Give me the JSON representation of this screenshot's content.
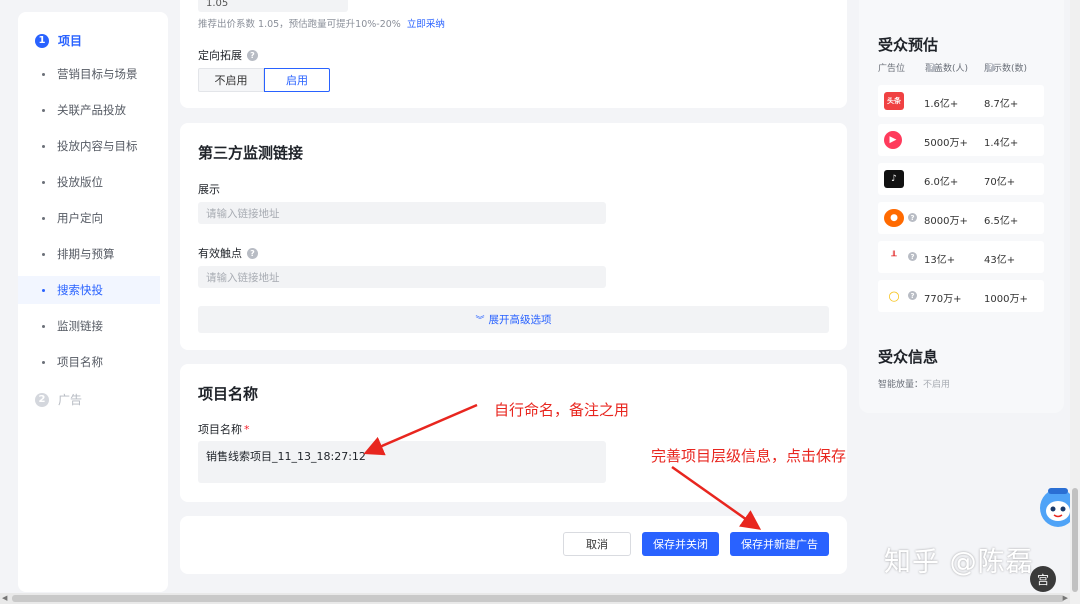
{
  "nav": {
    "step1": {
      "num": "1",
      "label": "项目"
    },
    "items": [
      {
        "label": "营销目标与场景"
      },
      {
        "label": "关联产品投放"
      },
      {
        "label": "投放内容与目标"
      },
      {
        "label": "投放版位"
      },
      {
        "label": "用户定向"
      },
      {
        "label": "排期与预算"
      },
      {
        "label": "搜索快投"
      },
      {
        "label": "监测链接"
      },
      {
        "label": "项目名称"
      }
    ],
    "selected_item": "搜索快投",
    "step2": {
      "num": "2",
      "label": "广告"
    }
  },
  "bid": {
    "value": "1.05",
    "hint": "推荐出价系数 1.05，预估跑量可提升10%-20%",
    "hint_link": "立即采纳"
  },
  "targeting_expand": {
    "label": "定向拓展",
    "options": [
      "不启用",
      "启用"
    ],
    "selected": "启用"
  },
  "monitor": {
    "title": "第三方监测链接",
    "show_label": "展示",
    "show_placeholder": "请输入链接地址",
    "touch_label": "有效触点",
    "touch_placeholder": "请输入链接地址",
    "expand_label": "展开高级选项"
  },
  "project_name": {
    "title": "项目名称",
    "label": "项目名称",
    "required_mark": "*",
    "value": "销售线索项目_11_13_18:27:12"
  },
  "actions": {
    "cancel": "取消",
    "save_close": "保存并关闭",
    "save_new": "保存并新建广告"
  },
  "audience": {
    "title": "受众预估",
    "columns": [
      "广告位",
      "覆盖数(人)",
      "展示数(数)"
    ],
    "rows": [
      {
        "logo_icon": "toutiao-logo-icon",
        "logo_text": "头条",
        "logo_color": "#f04142",
        "has_help": false,
        "coverage": "1.6亿+",
        "impressions": "8.7亿+"
      },
      {
        "logo_icon": "xigua-logo-icon",
        "logo_text": "▶",
        "logo_color": "#ff3b5c",
        "has_help": false,
        "coverage": "5000万+",
        "impressions": "1.4亿+"
      },
      {
        "logo_icon": "douyin-logo-icon",
        "logo_text": "♪",
        "logo_color": "#111111",
        "has_help": false,
        "coverage": "6.0亿+",
        "impressions": "70亿+"
      },
      {
        "logo_icon": "huoshan-logo-icon",
        "logo_text": "●",
        "logo_color": "#ff6a00",
        "has_help": true,
        "coverage": "8000万+",
        "impressions": "6.5亿+"
      },
      {
        "logo_icon": "pangle-logo-icon",
        "logo_text": "╨",
        "logo_color": "#e02020",
        "has_help": true,
        "coverage": "13亿+",
        "impressions": "43亿+"
      },
      {
        "logo_icon": "coin-logo-icon",
        "logo_text": "○",
        "logo_color": "#f7c31a",
        "has_help": true,
        "coverage": "770万+",
        "impressions": "1000万+"
      }
    ],
    "info_title": "受众信息",
    "smart_label": "智能放量：",
    "smart_value": "不启用"
  },
  "annotations": {
    "note1": "自行命名，备注之用",
    "note2": "完善项目层级信息，点击保存",
    "color": "#e8261f"
  },
  "watermark": "知乎 @陈磊",
  "badge": "宫",
  "accent": "#2962ff"
}
